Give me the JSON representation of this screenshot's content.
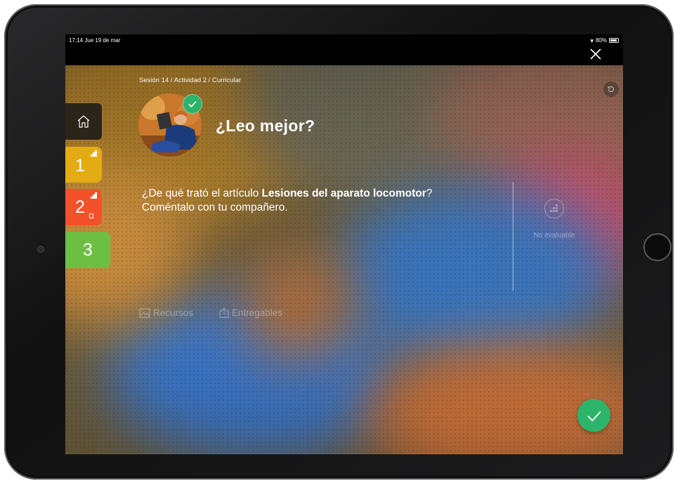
{
  "status_bar": {
    "time": "17:14  Jue 19 de mar",
    "battery": "80%"
  },
  "breadcrumb": "Sesión 14 / Actividad 2 / Curricular",
  "activity": {
    "title": "¿Leo mejor?",
    "question_pre": "¿De qué trató el artículo ",
    "question_bold": "Lesiones del aparato locomotor",
    "question_post": "?",
    "question_line2": "Coméntalo con tu compañero."
  },
  "evaluation": {
    "label": "No evaluable"
  },
  "links": {
    "resources": "Recursos",
    "deliverables": "Entregables"
  },
  "tabs": [
    {
      "label": "1",
      "color": "#e3ac12"
    },
    {
      "label": "2",
      "color": "#f3512a"
    },
    {
      "label": "3",
      "color": "#6dbf44"
    }
  ],
  "colors": {
    "accent_green": "#2cb46a"
  },
  "icons": [
    "home-icon",
    "close-icon",
    "reset-icon",
    "check-icon",
    "image-icon",
    "upload-icon",
    "grid-icon",
    "lock-icon",
    "wifi-icon",
    "battery-icon"
  ]
}
